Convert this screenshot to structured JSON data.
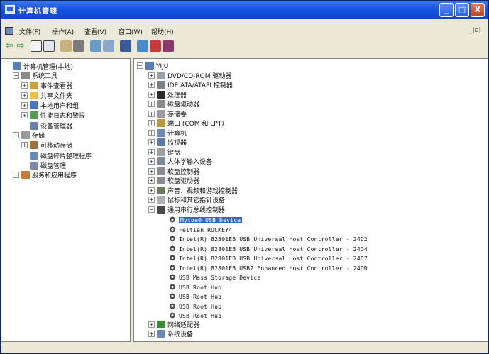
{
  "window": {
    "title": "计算机管理",
    "controls": {
      "minimize": "_",
      "maximize": "□",
      "close": "X"
    }
  },
  "menubar": {
    "items": [
      "文件(F)",
      "操作(A)",
      "查看(V)",
      "窗口(W)",
      "帮助(H)"
    ],
    "mdi_controls": "_|&#9633;|"
  },
  "toolbar": {
    "buttons": [
      "back-icon",
      "forward-icon",
      "show-hide-tree-icon",
      "up-icon",
      "properties-icon",
      "print-icon",
      "refresh-icon",
      "export-icon",
      "help-icon",
      "scan-hardware-icon",
      "uninstall-icon",
      "disable-icon"
    ]
  },
  "left_tree": [
    {
      "label": "计算机管理(本地)",
      "level": 0,
      "exp": "",
      "icon": "computer-management-icon",
      "color": "#5a7fb8"
    },
    {
      "label": "系统工具",
      "level": 1,
      "exp": "−",
      "icon": "system-tools-icon",
      "color": "#8a8a8a"
    },
    {
      "label": "事件查看器",
      "level": 2,
      "exp": "+",
      "icon": "event-viewer-icon",
      "color": "#c9a23a"
    },
    {
      "label": "共享文件夹",
      "level": 2,
      "exp": "+",
      "icon": "shared-folders-icon",
      "color": "#e8c14a"
    },
    {
      "label": "本地用户和组",
      "level": 2,
      "exp": "+",
      "icon": "users-icon",
      "color": "#4a78c8"
    },
    {
      "label": "性能日志和警报",
      "level": 2,
      "exp": "+",
      "icon": "performance-logs-icon",
      "color": "#5a9a5a"
    },
    {
      "label": "设备管理器",
      "level": 2,
      "exp": "",
      "icon": "device-manager-icon",
      "color": "#6a7fa8"
    },
    {
      "label": "存储",
      "level": 1,
      "exp": "−",
      "icon": "storage-icon",
      "color": "#9a9a9a"
    },
    {
      "label": "可移动存储",
      "level": 2,
      "exp": "+",
      "icon": "removable-storage-icon",
      "color": "#a0703a"
    },
    {
      "label": "磁盘碎片整理程序",
      "level": 2,
      "exp": "",
      "icon": "defrag-icon",
      "color": "#6a8ab8"
    },
    {
      "label": "磁盘管理",
      "level": 2,
      "exp": "",
      "icon": "disk-management-icon",
      "color": "#7a8aa8"
    },
    {
      "label": "服务和应用程序",
      "level": 1,
      "exp": "+",
      "icon": "services-icon",
      "color": "#c87a3a"
    }
  ],
  "right_tree": [
    {
      "label": "YIJU",
      "level": 0,
      "exp": "−",
      "icon": "computer-icon",
      "color": "#5a7fb8"
    },
    {
      "label": "DVD/CD-ROM 驱动器",
      "level": 1,
      "exp": "+",
      "icon": "dvd-icon",
      "color": "#9aa0a8"
    },
    {
      "label": "IDE ATA/ATAPI 控制器",
      "level": 1,
      "exp": "+",
      "icon": "ide-controller-icon",
      "color": "#7a8090"
    },
    {
      "label": "处理器",
      "level": 1,
      "exp": "+",
      "icon": "processor-icon",
      "color": "#2a2a2a"
    },
    {
      "label": "磁盘驱动器",
      "level": 1,
      "exp": "+",
      "icon": "disk-drive-icon",
      "color": "#8a8a8a"
    },
    {
      "label": "存储卷",
      "level": 1,
      "exp": "+",
      "icon": "storage-volume-icon",
      "color": "#9a9a9a"
    },
    {
      "label": "端口 (COM 和 LPT)",
      "level": 1,
      "exp": "+",
      "icon": "port-icon",
      "color": "#b89a3a"
    },
    {
      "label": "计算机",
      "level": 1,
      "exp": "+",
      "icon": "computer-node-icon",
      "color": "#6a8ab8"
    },
    {
      "label": "监视器",
      "level": 1,
      "exp": "+",
      "icon": "monitor-icon",
      "color": "#5a7aa8"
    },
    {
      "label": "键盘",
      "level": 1,
      "exp": "+",
      "icon": "keyboard-icon",
      "color": "#9aa0a8"
    },
    {
      "label": "人体学输入设备",
      "level": 1,
      "exp": "+",
      "icon": "hid-icon",
      "color": "#7a8a9a"
    },
    {
      "label": "软盘控制器",
      "level": 1,
      "exp": "+",
      "icon": "floppy-controller-icon",
      "color": "#8a8a9a"
    },
    {
      "label": "软盘驱动器",
      "level": 1,
      "exp": "+",
      "icon": "floppy-drive-icon",
      "color": "#8a8a9a"
    },
    {
      "label": "声音、视频和游戏控制器",
      "level": 1,
      "exp": "+",
      "icon": "sound-icon",
      "color": "#6a7a5a"
    },
    {
      "label": "鼠标和其它指针设备",
      "level": 1,
      "exp": "+",
      "icon": "mouse-icon",
      "color": "#aab0b8"
    },
    {
      "label": "通用串行总线控制器",
      "level": 1,
      "exp": "−",
      "icon": "usb-controller-icon",
      "color": "#4a4a4a"
    },
    {
      "label": "Mytoe0 USB Device",
      "level": 2,
      "exp": "",
      "icon": "usb-icon",
      "usb": true,
      "selected": true
    },
    {
      "label": "Feitian ROCKEY4",
      "level": 2,
      "exp": "",
      "icon": "usb-icon",
      "usb": true
    },
    {
      "label": "Intel(R) 82801EB USB Universal Host Controller - 24D2",
      "level": 2,
      "exp": "",
      "icon": "usb-icon",
      "usb": true
    },
    {
      "label": "Intel(R) 82801EB USB Universal Host Controller - 24D4",
      "level": 2,
      "exp": "",
      "icon": "usb-icon",
      "usb": true
    },
    {
      "label": "Intel(R) 82801EB USB Universal Host Controller - 24D7",
      "level": 2,
      "exp": "",
      "icon": "usb-icon",
      "usb": true
    },
    {
      "label": "Intel(R) 82801EB USB2 Enhanced Host Controller - 24DD",
      "level": 2,
      "exp": "",
      "icon": "usb-icon",
      "usb": true
    },
    {
      "label": "USB Mass Storage Device",
      "level": 2,
      "exp": "",
      "icon": "usb-icon",
      "usb": true
    },
    {
      "label": "USB Root Hub",
      "level": 2,
      "exp": "",
      "icon": "usb-icon",
      "usb": true
    },
    {
      "label": "USB Root Hub",
      "level": 2,
      "exp": "",
      "icon": "usb-icon",
      "usb": true
    },
    {
      "label": "USB Root Hub",
      "level": 2,
      "exp": "",
      "icon": "usb-icon",
      "usb": true
    },
    {
      "label": "USB Root Hub",
      "level": 2,
      "exp": "",
      "icon": "usb-icon",
      "usb": true
    },
    {
      "label": "网络适配器",
      "level": 1,
      "exp": "+",
      "icon": "network-adapter-icon",
      "color": "#3a8a3a"
    },
    {
      "label": "系统设备",
      "level": 1,
      "exp": "+",
      "icon": "system-devices-icon",
      "color": "#6a8ab8"
    }
  ]
}
